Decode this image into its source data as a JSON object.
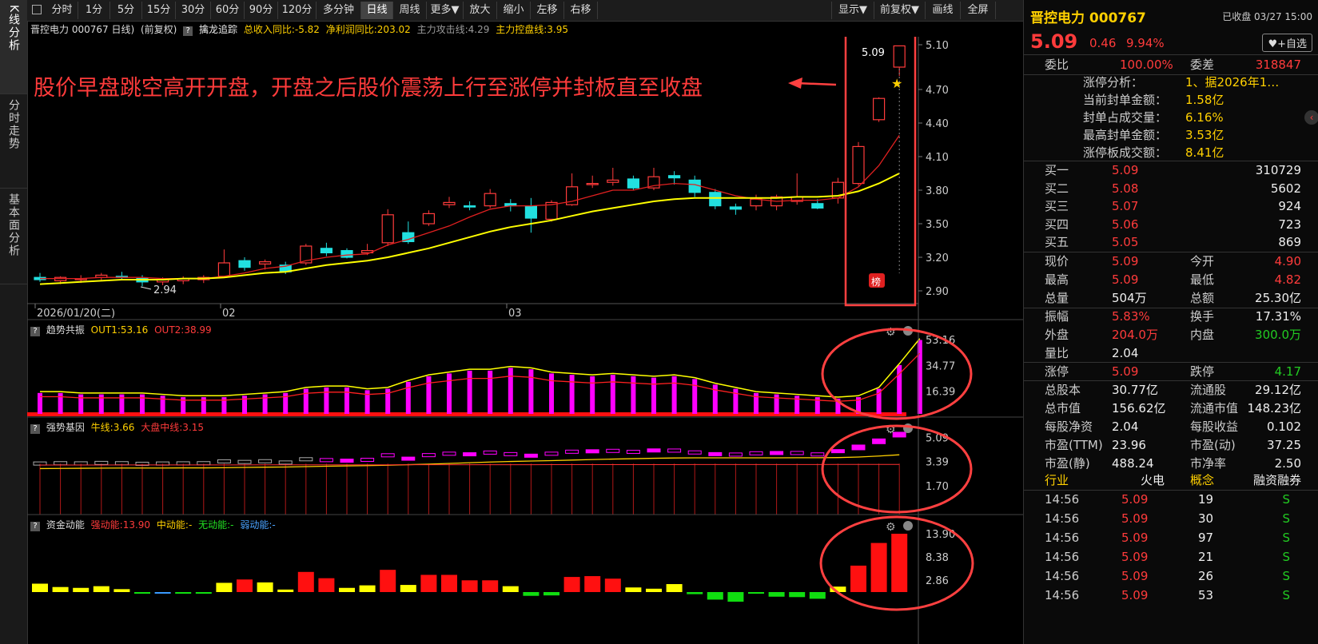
{
  "left_tabs": [
    {
      "label": "K线分析"
    },
    {
      "label": "分时走势"
    },
    {
      "label": "基本面分析"
    }
  ],
  "toolbar": {
    "items": [
      "分时",
      "1分",
      "5分",
      "15分",
      "30分",
      "60分",
      "90分",
      "120分",
      "多分钟",
      "日线",
      "周线",
      "更多▼",
      "放大",
      "缩小",
      "左移",
      "右移"
    ],
    "active": "日线",
    "right_items": [
      "显示▼",
      "前复权▼",
      "画线",
      "全屏"
    ]
  },
  "chart_header": {
    "stock": "晋控电力 000767 日线)",
    "adjust": "(前复权)",
    "indicator": "擒龙追踪",
    "revenue": "总收入同比:-5.82",
    "profit": "净利润同比:203.02",
    "attack": "主力攻击线:4.29",
    "control": "主力控盘线:3.95"
  },
  "annotation": "股价早盘跳空高开开盘，开盘之后股价震荡上行至涨停并封板直至收盘",
  "main_chart": {
    "y_ticks": [
      "5.10",
      "4.70",
      "4.40",
      "4.10",
      "3.80",
      "3.50",
      "3.20",
      "2.90"
    ],
    "date_labels": [
      "2026/01/20(二)",
      "02",
      "03"
    ],
    "low_label": "2.94",
    "high_label": "5.09",
    "badge": "榜"
  },
  "chart_data": [
    {
      "type": "candlestick",
      "title": "晋控电力 000767 日线",
      "ylim": [
        2.85,
        5.15
      ],
      "candles": [
        {
          "o": 3.02,
          "h": 3.06,
          "l": 2.98,
          "c": 3.0
        },
        {
          "o": 2.99,
          "h": 3.03,
          "l": 2.96,
          "c": 3.02
        },
        {
          "o": 3.0,
          "h": 3.04,
          "l": 2.97,
          "c": 3.01
        },
        {
          "o": 3.02,
          "h": 3.06,
          "l": 2.99,
          "c": 3.04
        },
        {
          "o": 3.03,
          "h": 3.07,
          "l": 3.0,
          "c": 3.02
        },
        {
          "o": 3.01,
          "h": 3.04,
          "l": 2.94,
          "c": 2.98
        },
        {
          "o": 2.98,
          "h": 3.02,
          "l": 2.95,
          "c": 3.0
        },
        {
          "o": 2.99,
          "h": 3.03,
          "l": 2.96,
          "c": 3.01
        },
        {
          "o": 3.0,
          "h": 3.04,
          "l": 2.97,
          "c": 3.02
        },
        {
          "o": 3.03,
          "h": 3.27,
          "l": 3.02,
          "c": 3.15
        },
        {
          "o": 3.17,
          "h": 3.2,
          "l": 3.08,
          "c": 3.11
        },
        {
          "o": 3.14,
          "h": 3.18,
          "l": 3.09,
          "c": 3.16
        },
        {
          "o": 3.13,
          "h": 3.16,
          "l": 3.05,
          "c": 3.07
        },
        {
          "o": 3.15,
          "h": 3.32,
          "l": 3.13,
          "c": 3.3
        },
        {
          "o": 3.28,
          "h": 3.33,
          "l": 3.21,
          "c": 3.24
        },
        {
          "o": 3.26,
          "h": 3.28,
          "l": 3.19,
          "c": 3.2
        },
        {
          "o": 3.24,
          "h": 3.32,
          "l": 3.22,
          "c": 3.26
        },
        {
          "o": 3.33,
          "h": 3.63,
          "l": 3.3,
          "c": 3.58
        },
        {
          "o": 3.42,
          "h": 3.52,
          "l": 3.32,
          "c": 3.34
        },
        {
          "o": 3.5,
          "h": 3.62,
          "l": 3.48,
          "c": 3.59
        },
        {
          "o": 3.67,
          "h": 3.74,
          "l": 3.64,
          "c": 3.69
        },
        {
          "o": 3.66,
          "h": 3.7,
          "l": 3.62,
          "c": 3.65
        },
        {
          "o": 3.66,
          "h": 3.81,
          "l": 3.64,
          "c": 3.77
        },
        {
          "o": 3.68,
          "h": 3.72,
          "l": 3.61,
          "c": 3.66
        },
        {
          "o": 3.66,
          "h": 3.73,
          "l": 3.42,
          "c": 3.55
        },
        {
          "o": 3.54,
          "h": 3.71,
          "l": 3.52,
          "c": 3.69
        },
        {
          "o": 3.67,
          "h": 3.95,
          "l": 3.66,
          "c": 3.83
        },
        {
          "o": 3.85,
          "h": 3.93,
          "l": 3.82,
          "c": 3.86
        },
        {
          "o": 3.87,
          "h": 4.0,
          "l": 3.84,
          "c": 3.89
        },
        {
          "o": 3.9,
          "h": 3.93,
          "l": 3.8,
          "c": 3.82
        },
        {
          "o": 3.82,
          "h": 4.0,
          "l": 3.8,
          "c": 3.92
        },
        {
          "o": 3.93,
          "h": 3.97,
          "l": 3.85,
          "c": 3.91
        },
        {
          "o": 3.89,
          "h": 3.93,
          "l": 3.74,
          "c": 3.78
        },
        {
          "o": 3.78,
          "h": 3.81,
          "l": 3.63,
          "c": 3.66
        },
        {
          "o": 3.65,
          "h": 3.68,
          "l": 3.58,
          "c": 3.63
        },
        {
          "o": 3.66,
          "h": 3.76,
          "l": 3.62,
          "c": 3.72
        },
        {
          "o": 3.66,
          "h": 3.76,
          "l": 3.62,
          "c": 3.74
        },
        {
          "o": 3.7,
          "h": 3.95,
          "l": 3.67,
          "c": 3.74
        },
        {
          "o": 3.68,
          "h": 3.72,
          "l": 3.63,
          "c": 3.64
        },
        {
          "o": 3.73,
          "h": 3.91,
          "l": 3.68,
          "c": 3.87
        },
        {
          "o": 3.86,
          "h": 4.23,
          "l": 3.84,
          "c": 4.19
        },
        {
          "o": 4.43,
          "h": 4.63,
          "l": 4.41,
          "c": 4.62
        },
        {
          "o": 4.9,
          "h": 5.09,
          "l": 4.82,
          "c": 5.09
        }
      ],
      "ma_red": [
        3.01,
        3.01,
        3.01,
        3.02,
        3.02,
        3.02,
        3.01,
        3.01,
        3.01,
        3.03,
        3.06,
        3.1,
        3.12,
        3.17,
        3.2,
        3.22,
        3.23,
        3.31,
        3.36,
        3.42,
        3.48,
        3.56,
        3.63,
        3.66,
        3.66,
        3.67,
        3.7,
        3.75,
        3.8,
        3.8,
        3.84,
        3.86,
        3.85,
        3.8,
        3.75,
        3.72,
        3.7,
        3.71,
        3.71,
        3.73,
        3.83,
        4.02,
        4.29
      ],
      "ma_yellow": [
        2.96,
        2.97,
        2.98,
        2.99,
        3.0,
        3.0,
        3.0,
        3.01,
        3.01,
        3.02,
        3.04,
        3.06,
        3.07,
        3.1,
        3.13,
        3.15,
        3.17,
        3.2,
        3.24,
        3.28,
        3.33,
        3.38,
        3.43,
        3.47,
        3.5,
        3.53,
        3.57,
        3.61,
        3.64,
        3.67,
        3.7,
        3.72,
        3.73,
        3.73,
        3.73,
        3.73,
        3.73,
        3.74,
        3.74,
        3.75,
        3.79,
        3.86,
        3.95
      ]
    },
    {
      "type": "bar",
      "title": "趋势共振",
      "series": [
        {
          "name": "OUT1",
          "last": "53.16"
        },
        {
          "name": "OUT2",
          "last": "38.99"
        }
      ],
      "values": [
        15,
        15,
        14,
        14,
        14,
        14,
        13,
        12,
        12,
        12,
        13,
        14,
        15,
        18,
        19,
        19,
        17,
        18,
        23,
        27,
        29,
        31,
        31,
        33,
        32,
        29,
        28,
        27,
        28,
        27,
        26,
        27,
        25,
        21,
        18,
        15,
        14,
        13,
        12,
        11,
        12,
        18,
        35,
        53
      ],
      "ylim": [
        0,
        55
      ],
      "y_ticks": [
        "53.16",
        "34.77",
        "16.39"
      ]
    },
    {
      "type": "bar",
      "title": "强势基因",
      "legend": [
        "牛线:3.66",
        "大盘中线:3.15"
      ],
      "y_ticks": [
        "5.09",
        "3.39",
        "1.70"
      ]
    },
    {
      "type": "bar",
      "title": "资金动能",
      "legend": [
        "强动能:13.90",
        "中动能:-",
        "无动能:-",
        "弱动能:-"
      ],
      "values": [
        2.0,
        1.2,
        1.0,
        1.4,
        0.7,
        -0.4,
        -0.3,
        -0.4,
        -0.4,
        2.2,
        3.0,
        2.3,
        0.6,
        4.8,
        3.3,
        1.0,
        1.6,
        5.3,
        1.7,
        4.1,
        4.1,
        2.8,
        2.8,
        1.4,
        -0.9,
        -0.8,
        3.6,
        3.8,
        3.2,
        1.1,
        0.8,
        1.9,
        -0.5,
        -1.8,
        -2.3,
        -0.4,
        -1.1,
        -1.2,
        -1.6,
        1.3,
        6.3,
        11.7,
        13.9
      ],
      "ylim": [
        -3,
        14
      ],
      "y_ticks": [
        "13.90",
        "8.38",
        "2.86"
      ]
    }
  ],
  "sub_panels": {
    "p1": {
      "title": "趋势共振",
      "out1": "OUT1:53.16",
      "out2": "OUT2:38.99"
    },
    "p2": {
      "title": "强势基因",
      "l1": "牛线:3.66",
      "l2": "大盘中线:3.15"
    },
    "p3": {
      "title": "资金动能",
      "l1": "强动能:13.90",
      "l2": "中动能:-",
      "l3": "无动能:-",
      "l4": "弱动能:-"
    }
  },
  "quote": {
    "name": "晋控电力 000767",
    "status": "已收盘 03/27 15:00",
    "price": "5.09",
    "change": "0.46",
    "pct": "9.94%",
    "watch_btn": "♥+自选",
    "weibi_label": "委比",
    "weibi": "100.00%",
    "weicha_label": "委差",
    "weicha": "318847",
    "limit": [
      {
        "label": "涨停分析：",
        "value": "1、据2026年1…"
      },
      {
        "label": "当前封单金额：",
        "value": "1.58亿"
      },
      {
        "label": "封单占成交量：",
        "value": "6.16%"
      },
      {
        "label": "最高封单金额：",
        "value": "3.53亿"
      },
      {
        "label": "涨停板成交额：",
        "value": "8.41亿"
      }
    ],
    "bids": [
      {
        "label": "买一",
        "price": "5.09",
        "vol": "310729"
      },
      {
        "label": "买二",
        "price": "5.08",
        "vol": "5602"
      },
      {
        "label": "买三",
        "price": "5.07",
        "vol": "924"
      },
      {
        "label": "买四",
        "price": "5.06",
        "vol": "723"
      },
      {
        "label": "买五",
        "price": "5.05",
        "vol": "869"
      }
    ],
    "stats1": [
      {
        "l1": "现价",
        "v1": "5.09",
        "c1": "red",
        "l2": "今开",
        "v2": "4.90",
        "c2": "red"
      },
      {
        "l1": "最高",
        "v1": "5.09",
        "c1": "red",
        "l2": "最低",
        "v2": "4.82",
        "c2": "red"
      },
      {
        "l1": "总量",
        "v1": "504万",
        "c1": "white",
        "l2": "总额",
        "v2": "25.30亿",
        "c2": "white"
      }
    ],
    "stats2": [
      {
        "l1": "振幅",
        "v1": "5.83%",
        "c1": "red",
        "l2": "换手",
        "v2": "17.31%",
        "c2": "white"
      },
      {
        "l1": "外盘",
        "v1": "204.0万",
        "c1": "red",
        "l2": "内盘",
        "v2": "300.0万",
        "c2": "green"
      },
      {
        "l1": "量比",
        "v1": "2.04",
        "c1": "white",
        "l2": "",
        "v2": "",
        "c2": "white"
      }
    ],
    "stats3": [
      {
        "l1": "涨停",
        "v1": "5.09",
        "c1": "red",
        "l2": "跌停",
        "v2": "4.17",
        "c2": "green"
      }
    ],
    "stats4": [
      {
        "l1": "总股本",
        "v1": "30.77亿",
        "c1": "white",
        "l2": "流通股",
        "v2": "29.12亿",
        "c2": "white"
      },
      {
        "l1": "总市值",
        "v1": "156.62亿",
        "c1": "white",
        "l2": "流通市值",
        "v2": "148.23亿",
        "c2": "white"
      },
      {
        "l1": "每股净资",
        "v1": "2.04",
        "c1": "white",
        "l2": "每股收益",
        "v2": "0.102",
        "c2": "white"
      },
      {
        "l1": "市盈(TTM)",
        "v1": "23.96",
        "c1": "white",
        "l2": "市盈(动)",
        "v2": "37.25",
        "c2": "white"
      },
      {
        "l1": "市盈(静)",
        "v1": "488.24",
        "c1": "white",
        "l2": "市净率",
        "v2": "2.50",
        "c2": "white"
      }
    ],
    "tags": {
      "industry": "行业",
      "industry_val": "火电",
      "concept": "概念",
      "margin": "融资融券"
    },
    "ticks": [
      {
        "t": "14:56",
        "p": "5.09",
        "v": "19",
        "s": "S"
      },
      {
        "t": "14:56",
        "p": "5.09",
        "v": "30",
        "s": "S"
      },
      {
        "t": "14:56",
        "p": "5.09",
        "v": "97",
        "s": "S"
      },
      {
        "t": "14:56",
        "p": "5.09",
        "v": "21",
        "s": "S"
      },
      {
        "t": "14:56",
        "p": "5.09",
        "v": "26",
        "s": "S"
      },
      {
        "t": "14:56",
        "p": "5.09",
        "v": "53",
        "s": "S"
      }
    ]
  },
  "colors": {
    "up": "#ff3b3b",
    "down": "#22e0e0",
    "ma_red": "#e02020",
    "ma_yellow": "#ffff00",
    "magenta": "#ff00ff",
    "highlight": "#ff4040"
  }
}
